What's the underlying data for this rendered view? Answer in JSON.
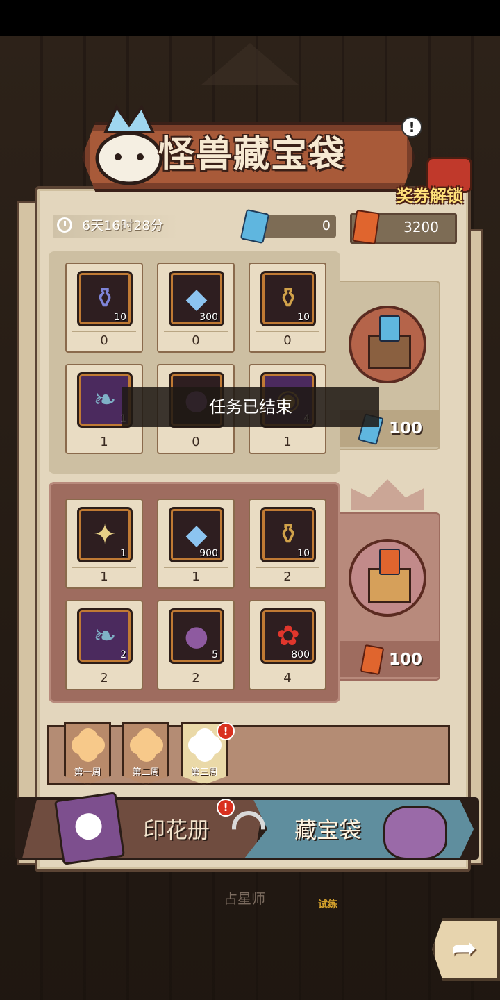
{
  "title": "怪兽藏宝袋",
  "voucher_unlock": "奖券解锁",
  "timer": "6天16时28分",
  "blue_tickets": "0",
  "gold_tickets": "3200",
  "toast": "任务已结束",
  "top_rewards": [
    {
      "name": "vase-icon",
      "qty": "10",
      "count": "0"
    },
    {
      "name": "crystal-icon",
      "qty": "300",
      "count": "0"
    },
    {
      "name": "golden-jar-icon",
      "qty": "10",
      "count": "0"
    },
    {
      "name": "feather-icon",
      "qty": "1",
      "count": "1"
    },
    {
      "name": "pouch-icon",
      "qty": "",
      "count": "0"
    },
    {
      "name": "coins-icon",
      "qty": "4",
      "count": "1"
    }
  ],
  "bottom_rewards": [
    {
      "name": "spellbook-icon",
      "qty": "1",
      "count": "1"
    },
    {
      "name": "crystal-icon",
      "qty": "900",
      "count": "1"
    },
    {
      "name": "golden-jar-icon",
      "qty": "10",
      "count": "2"
    },
    {
      "name": "feather-icon",
      "qty": "2",
      "count": "2"
    },
    {
      "name": "cat-pouch-icon",
      "qty": "5",
      "count": "2"
    },
    {
      "name": "red-flower-icon",
      "qty": "800",
      "count": "4"
    }
  ],
  "chest_top_price": "100",
  "chest_bottom_price": "100",
  "weeks": [
    "第一周",
    "第二周",
    "第三周"
  ],
  "tabs": {
    "stamp_book": "印花册",
    "treasure_bag": "藏宝袋"
  },
  "alert_mark": "!",
  "below": {
    "astrologer": "占星师",
    "trial": "试练"
  },
  "colors": {
    "blue_ticket": "#5fb6df",
    "gold_ticket": "#e0652e",
    "panel": "#e3d6bd",
    "alert": "#d9301f"
  }
}
